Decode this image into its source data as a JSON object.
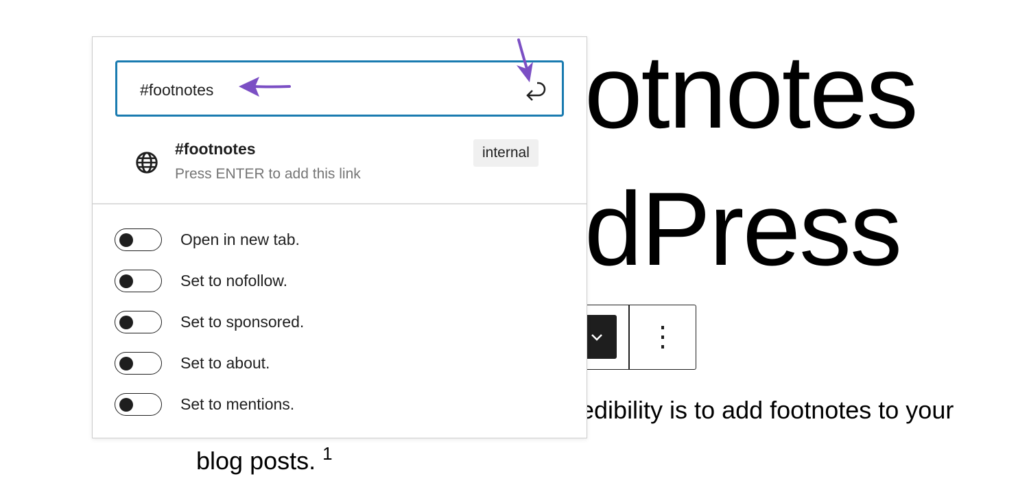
{
  "heading": {
    "line1": "otnotes",
    "line2": "dPress"
  },
  "paragraph": {
    "line1": "edibility is to add footnotes to your",
    "line2": "blog posts.",
    "footnote_ref": "1"
  },
  "link_popover": {
    "input_value": "#footnotes",
    "suggestion": {
      "title": "#footnotes",
      "subtitle": "Press ENTER to add this link",
      "badge": "internal",
      "icon": "globe-icon"
    },
    "submit_icon": "enter-icon",
    "toggles": [
      {
        "label": "Open in new tab.",
        "checked": false
      },
      {
        "label": "Set to nofollow.",
        "checked": false
      },
      {
        "label": "Set to sponsored.",
        "checked": false
      },
      {
        "label": "Set to about.",
        "checked": false
      },
      {
        "label": "Set to mentions.",
        "checked": false
      }
    ]
  },
  "annotation_color": "#7b4fc4",
  "accent_color": "#1a7bb0"
}
